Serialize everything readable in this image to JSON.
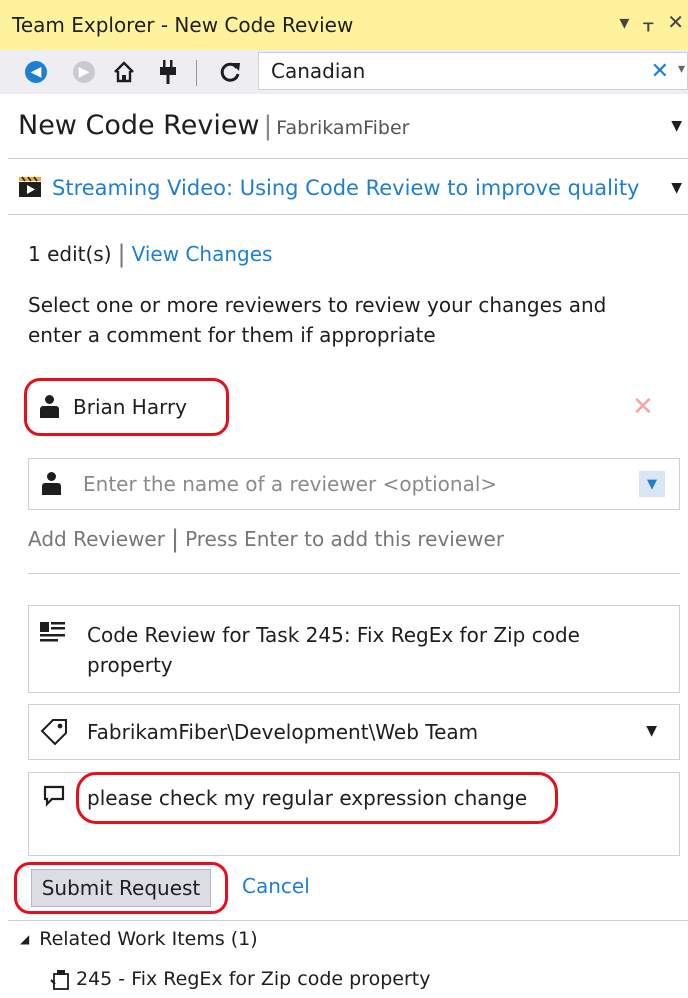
{
  "window": {
    "title": "Team Explorer - New Code Review",
    "controls": [
      "▾",
      "ᚁ",
      "✕"
    ]
  },
  "toolbar": {
    "back_icon": "back-arrow-icon",
    "forward_icon": "forward-arrow-icon",
    "home_icon": "home-icon",
    "connect_icon": "plug-icon",
    "refresh_icon": "refresh-icon",
    "search_value": "Canadian",
    "clear_glyph": "✕"
  },
  "header": {
    "title": "New Code Review",
    "separator": "|",
    "project": "FabrikamFiber"
  },
  "video": {
    "link": "Streaming Video: Using Code Review to improve quality"
  },
  "changes": {
    "edits": "1 edit(s)",
    "view_changes": "View Changes"
  },
  "instructions": "Select one or more reviewers to review your changes and enter a comment for them if appropriate",
  "reviewers": {
    "selected": "Brian Harry",
    "placeholder": "Enter the name of a reviewer <optional>",
    "add_label": "Add Reviewer",
    "add_hint": "Press Enter to add this reviewer"
  },
  "review": {
    "title": "Code Review for Task 245: Fix RegEx for Zip code property",
    "area_path": "FabrikamFiber\\Development\\Web Team",
    "comment": "please check my regular expression change"
  },
  "actions": {
    "submit": "Submit Request",
    "cancel": "Cancel"
  },
  "related": {
    "heading": "Related Work Items (1)",
    "items": [
      "245 - Fix RegEx for Zip code property"
    ]
  },
  "colors": {
    "title_bar": "#fff29d",
    "link": "#1e7fd2",
    "highlight": "#e3101b"
  }
}
